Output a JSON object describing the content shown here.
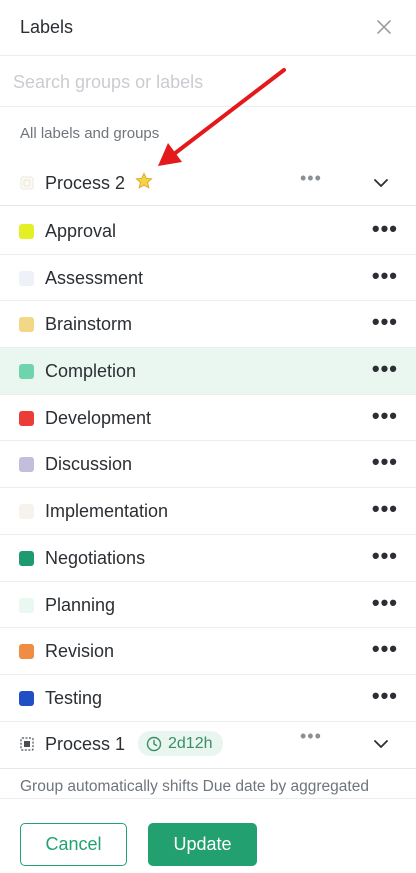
{
  "header": {
    "title": "Labels",
    "close_icon": "close-icon"
  },
  "search": {
    "placeholder": "Search groups or labels",
    "value": ""
  },
  "section_label": "All labels and groups",
  "groups": [
    {
      "name": "Process 2",
      "favorite_icon": "star-icon",
      "expanded": true
    },
    {
      "name": "Process 1",
      "timer": "2d12h",
      "timer_icon": "clock-icon",
      "expanded": false
    }
  ],
  "labels": [
    {
      "name": "Approval",
      "color": "#e3f025"
    },
    {
      "name": "Assessment",
      "color": "#eef1f8"
    },
    {
      "name": "Brainstorm",
      "color": "#f2d886"
    },
    {
      "name": "Completion",
      "color": "#6fd4ad",
      "highlighted": true
    },
    {
      "name": "Development",
      "color": "#eb3c38"
    },
    {
      "name": "Discussion",
      "color": "#c3bedc"
    },
    {
      "name": "Implementation",
      "color": "#f7f2ec"
    },
    {
      "name": "Negotiations",
      "color": "#1e9a6f"
    },
    {
      "name": "Planning",
      "color": "#e9f8f1"
    },
    {
      "name": "Revision",
      "color": "#ef8e42"
    },
    {
      "name": "Testing",
      "color": "#1f4fc4"
    }
  ],
  "footnote": "Group automatically shifts Due date by aggregated",
  "footer": {
    "cancel_label": "Cancel",
    "update_label": "Update"
  },
  "colors": {
    "accent": "#22a06f",
    "annotation_arrow": "#e3191c"
  }
}
